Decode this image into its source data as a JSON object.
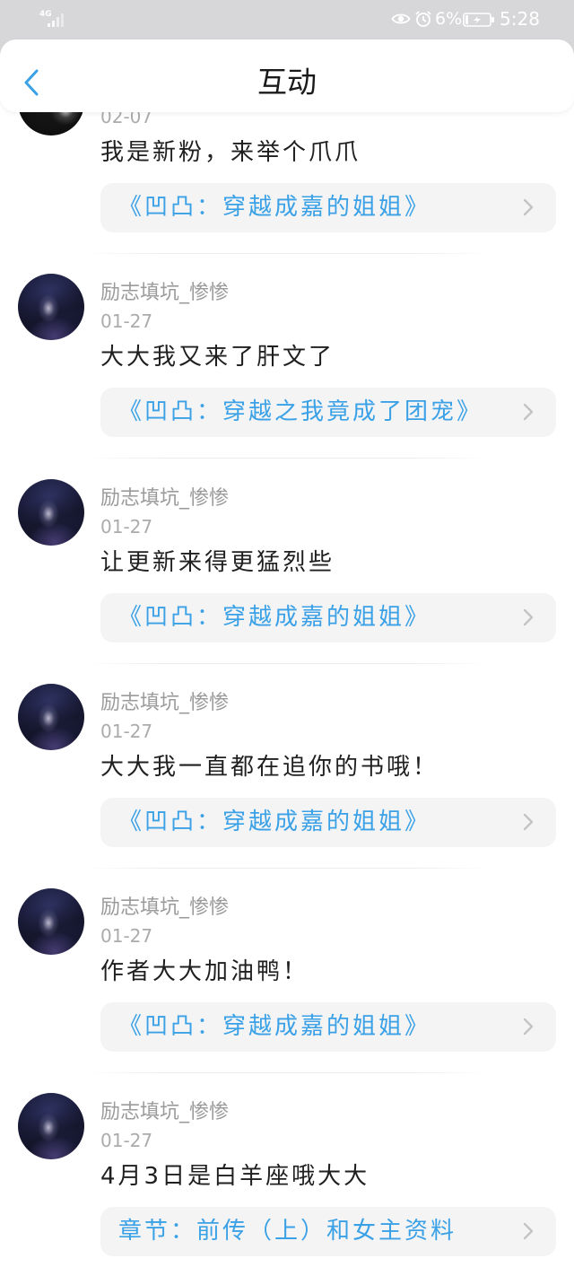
{
  "status_bar": {
    "network_label": "4G",
    "battery_percent": "6%",
    "time": "5:28",
    "icons": [
      "signal-icon",
      "eye-icon",
      "alarm-icon",
      "battery-charging-icon"
    ]
  },
  "header": {
    "title": "互动",
    "back_icon": "chevron-left-icon"
  },
  "comments": [
    {
      "date": "02-07",
      "text": "我是新粉，来举个爪爪",
      "link": "《凹凸：穿越成嘉的姐姐》"
    },
    {
      "name": "励志填坑_惨惨",
      "date": "01-27",
      "text": "大大我又来了肝文了",
      "link": "《凹凸：穿越之我竟成了团宠》"
    },
    {
      "name": "励志填坑_惨惨",
      "date": "01-27",
      "text": "让更新来得更猛烈些",
      "link": "《凹凸：穿越成嘉的姐姐》"
    },
    {
      "name": "励志填坑_惨惨",
      "date": "01-27",
      "text": "大大我一直都在追你的书哦！",
      "link": "《凹凸：穿越成嘉的姐姐》"
    },
    {
      "name": "励志填坑_惨惨",
      "date": "01-27",
      "text": "作者大大加油鸭！",
      "link": "《凹凸：穿越成嘉的姐姐》"
    },
    {
      "name": "励志填坑_惨惨",
      "date": "01-27",
      "text": "4月3日是白羊座哦大大",
      "link": "章节：前传（上）和女主资料"
    }
  ],
  "link_icon": "chevron-right-icon",
  "colors": {
    "accent": "#3aa1e6",
    "status_bg": "#d7d7d9",
    "card_bg": "#f4f4f5",
    "name_color": "#9b9b9b",
    "date_color": "#ababab",
    "text_color": "#1f1f1f",
    "chevron_color": "#c3c3c3"
  }
}
